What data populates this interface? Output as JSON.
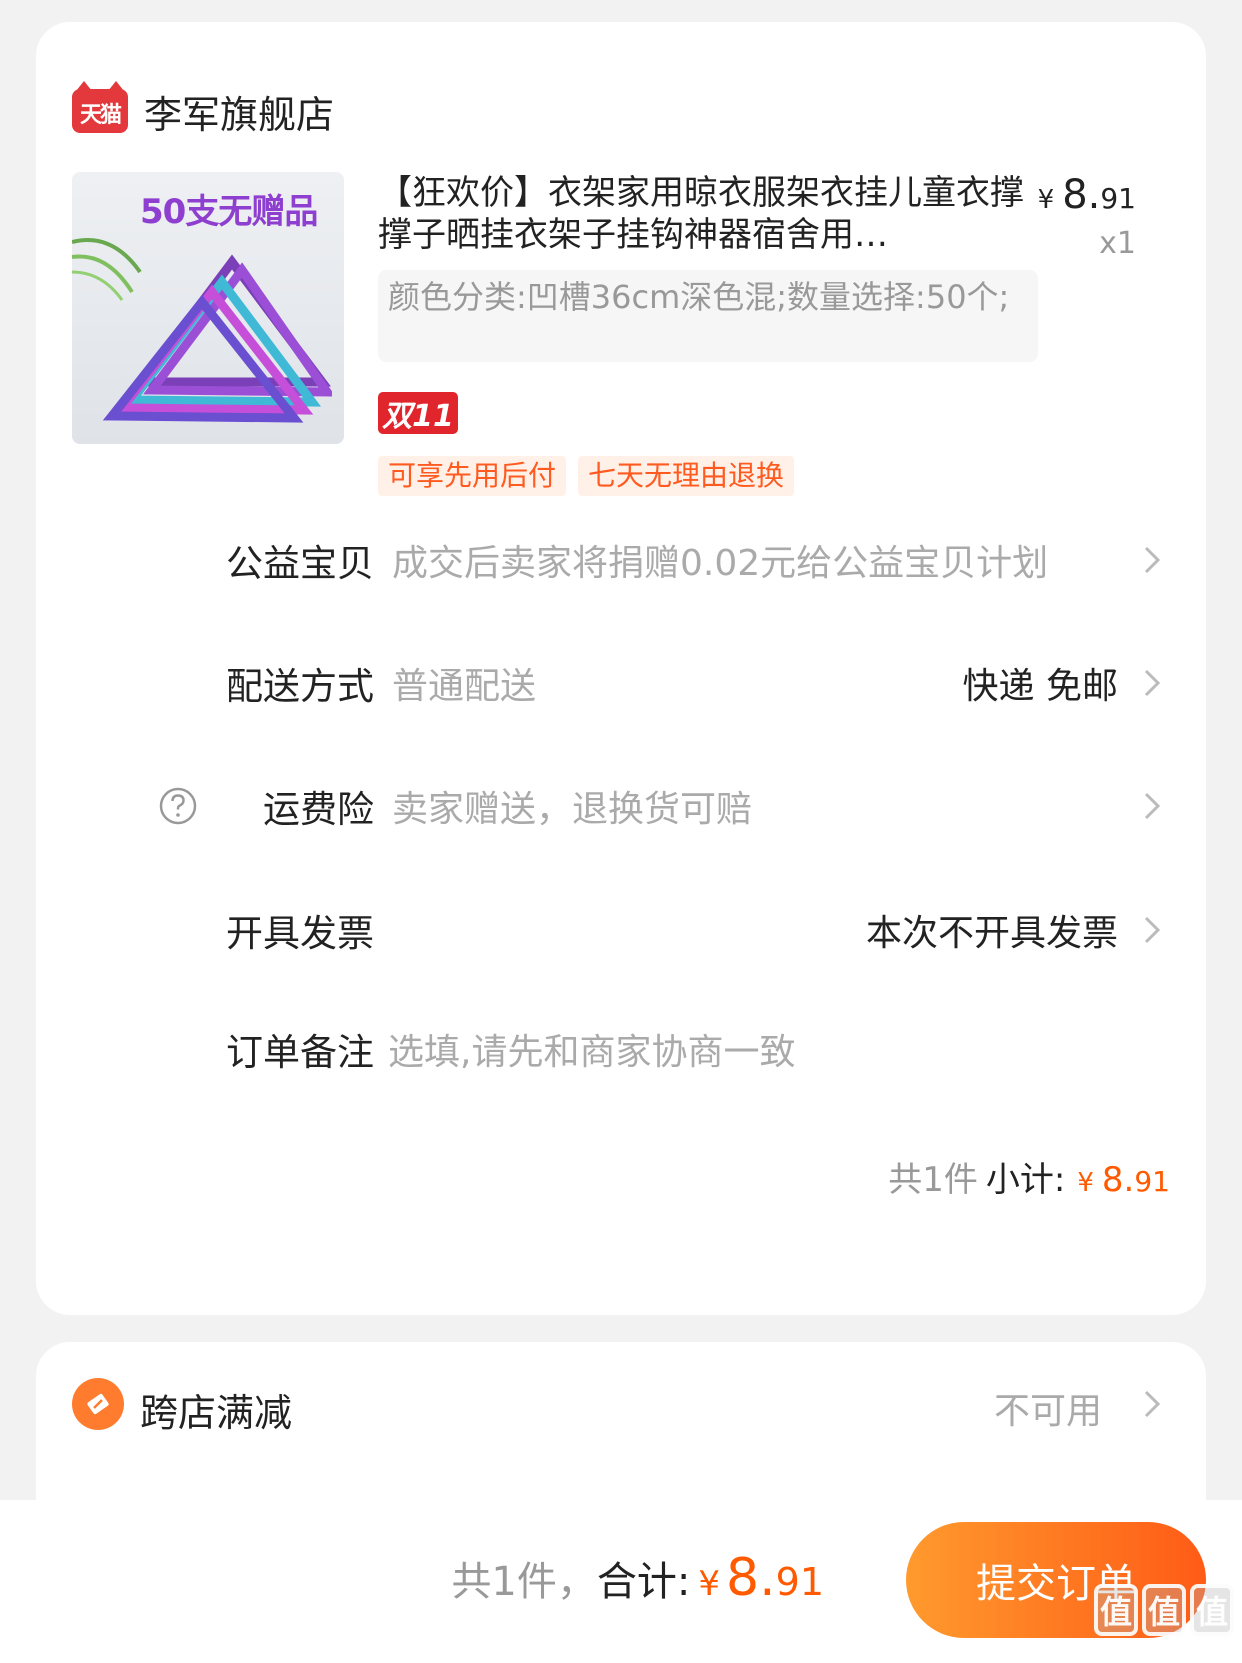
{
  "shop": {
    "logo_text": "天猫",
    "name": "李军旗舰店"
  },
  "product": {
    "image_banner": "50支无赠品",
    "title": "【狂欢价】衣架家用晾衣服架衣挂儿童衣撑撑子晒挂衣架子挂钩神器宿舍用…",
    "price_yen": "¥",
    "price_int": "8.",
    "price_dec": "91",
    "quantity": "x1",
    "sku": "颜色分类:凹槽36cm深色混;数量选择:50个;",
    "badge": "双11",
    "tags": [
      "可享先用后付",
      "七天无理由退换"
    ]
  },
  "rows": {
    "charity": {
      "label": "公益宝贝",
      "value": "成交后卖家将捐赠0.02元给公益宝贝计划"
    },
    "delivery": {
      "label": "配送方式",
      "value": "普通配送",
      "right": "快递 免邮"
    },
    "insurance": {
      "label": "运费险",
      "value": "卖家赠送，退换货可赔"
    },
    "invoice": {
      "label": "开具发票",
      "right": "本次不开具发票"
    },
    "note": {
      "label": "订单备注",
      "placeholder": "选填,请先和商家协商一致"
    }
  },
  "subtotal": {
    "count": "共1件",
    "label": "小计:",
    "yen": "¥",
    "int": "8.",
    "dec": "91"
  },
  "promo": {
    "label": "跨店满减",
    "status": "不可用"
  },
  "bottom": {
    "count": "共1件，",
    "label": "合计:",
    "yen": "¥",
    "int": "8.",
    "dec": "91",
    "submit": "提交订单"
  },
  "watermark": {
    "chars": [
      "值",
      "值",
      "值"
    ],
    "url": "zhizhizhi.com"
  },
  "colors": {
    "accent": "#ff5a00",
    "tmall_red": "#e4393c",
    "tag_bg": "#fff1e8"
  }
}
